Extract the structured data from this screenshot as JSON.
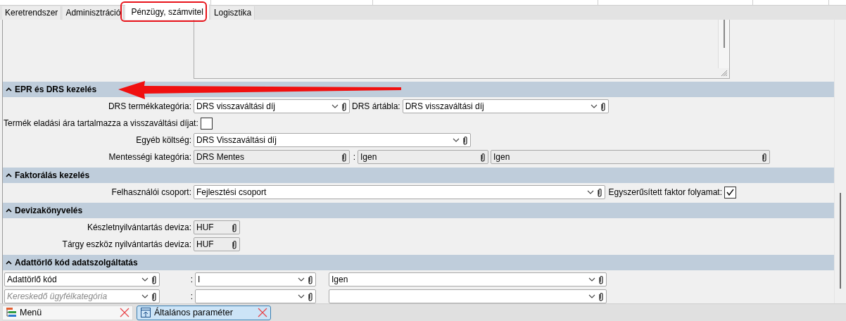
{
  "tabs": [
    {
      "label": "Keretrendszer",
      "selected": false
    },
    {
      "label": "Adminisztráció",
      "selected": false
    },
    {
      "label": "Pénzügy, számvitel",
      "selected": true
    },
    {
      "label": "Logisztika",
      "selected": false
    }
  ],
  "sections": [
    {
      "title": "EPR és DRS kezelés",
      "expanded": true,
      "rows": [
        {
          "items": [
            {
              "kind": "label",
              "text": "DRS termékkategória:"
            },
            {
              "kind": "combo",
              "value": "DRS visszaváltási díj",
              "readonly": false
            },
            {
              "kind": "label",
              "text": "DRS ártábla:"
            },
            {
              "kind": "combo",
              "value": "DRS visszaváltási díj",
              "readonly": false
            }
          ]
        },
        {
          "items": [
            {
              "kind": "label",
              "text": "Termék eladási ára tartalmazza a visszaváltási díjat:"
            },
            {
              "kind": "checkbox",
              "checked": false
            }
          ]
        },
        {
          "items": [
            {
              "kind": "label",
              "text": "Egyéb költség:"
            },
            {
              "kind": "combo",
              "value": "DRS Visszaváltási díj",
              "readonly": false
            }
          ]
        },
        {
          "items": [
            {
              "kind": "label",
              "text": "Mentességi kategória:"
            },
            {
              "kind": "lookup",
              "value": "DRS Mentes",
              "readonly": true
            },
            {
              "kind": "separator",
              "text": ":"
            },
            {
              "kind": "lookup",
              "value": "Igen",
              "readonly": true
            },
            {
              "kind": "lookup",
              "value": "Igen",
              "readonly": true
            }
          ]
        }
      ]
    },
    {
      "title": "Faktorálás kezelés",
      "expanded": true,
      "rows": [
        {
          "items": [
            {
              "kind": "label",
              "text": "Felhasználói csoport:"
            },
            {
              "kind": "combo",
              "value": "Fejlesztési csoport",
              "readonly": false
            },
            {
              "kind": "label",
              "text": "Egyszerűsített faktor folyamat:"
            },
            {
              "kind": "checkbox",
              "checked": true
            }
          ]
        }
      ]
    },
    {
      "title": "Devizakönyvelés",
      "expanded": true,
      "rows": [
        {
          "items": [
            {
              "kind": "label",
              "text": "Készletnyilvántartás deviza:"
            },
            {
              "kind": "lookup",
              "value": "HUF",
              "readonly": true
            }
          ]
        },
        {
          "items": [
            {
              "kind": "label",
              "text": "Tárgy eszköz nyilvántartás deviza:"
            },
            {
              "kind": "lookup",
              "value": "HUF",
              "readonly": true
            }
          ]
        }
      ]
    },
    {
      "title": "Adattörlő kód adatszolgáltatás",
      "expanded": true,
      "rows": [
        {
          "items": [
            {
              "kind": "combo",
              "value": "Adattörlő kód",
              "readonly": false
            },
            {
              "kind": "separator",
              "text": ":"
            },
            {
              "kind": "combo",
              "value": "I",
              "readonly": false
            },
            {
              "kind": "combo",
              "value": "Igen",
              "readonly": false
            }
          ]
        },
        {
          "items": [
            {
              "kind": "combo",
              "placeholder": "Kereskedő ügyfélkategória",
              "readonly": false
            },
            {
              "kind": "separator",
              "text": ":"
            },
            {
              "kind": "combo",
              "readonly": false
            },
            {
              "kind": "combo",
              "readonly": false
            }
          ]
        }
      ]
    }
  ],
  "taskbar": [
    {
      "label": "Menü",
      "selected": false
    },
    {
      "label": "Általános paraméter",
      "selected": true
    }
  ]
}
